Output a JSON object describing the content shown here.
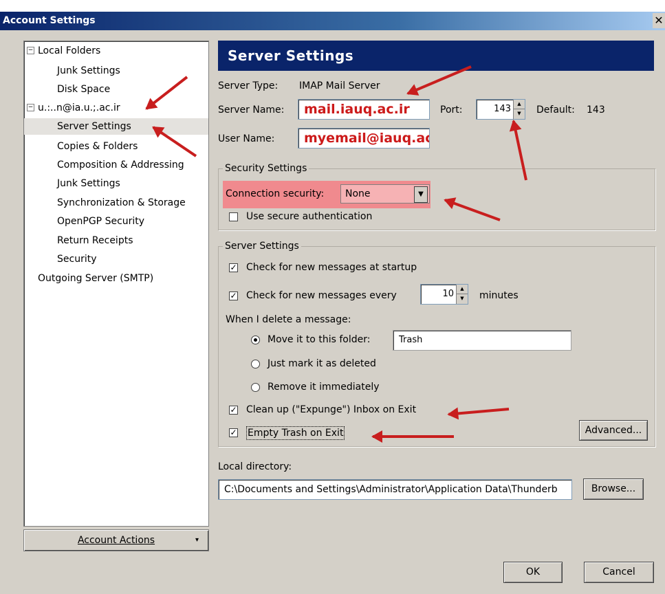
{
  "window": {
    "title": "Account Settings",
    "close_glyph": "✕"
  },
  "tree": {
    "expander_glyph": "−",
    "items": [
      {
        "label": "Local Folders"
      },
      {
        "label": "Junk Settings"
      },
      {
        "label": "Disk Space"
      },
      {
        "label": "u.:..n@ia.u.;.ac.ir"
      },
      {
        "label": "Server Settings"
      },
      {
        "label": "Copies & Folders"
      },
      {
        "label": "Composition & Addressing"
      },
      {
        "label": "Junk Settings"
      },
      {
        "label": "Synchronization & Storage"
      },
      {
        "label": "OpenPGP Security"
      },
      {
        "label": "Return Receipts"
      },
      {
        "label": "Security"
      },
      {
        "label": "Outgoing Server (SMTP)"
      }
    ],
    "account_actions": "Account Actions",
    "account_actions_arrow": "▾"
  },
  "panel": {
    "title": "Server Settings",
    "server_type_label": "Server Type:",
    "server_type_value": "IMAP Mail Server",
    "server_name_label": "Server Name:",
    "server_name_value": "mail.iauq.ac.ir",
    "port_label": "Port:",
    "port_value": "143",
    "default_label": "Default:",
    "default_value": "143",
    "user_name_label": "User Name:",
    "user_name_value": "myemail@iauq.ac.ir",
    "security_group_title": "Security Settings",
    "connection_security_label": "Connection security:",
    "connection_security_value": "None",
    "use_secure_auth_label": "Use secure authentication",
    "server_group_title": "Server Settings",
    "check_startup_label": "Check for new messages at startup",
    "check_every_label": "Check for new messages every",
    "check_every_value": "10",
    "minutes_label": "minutes",
    "delete_heading": "When I delete a message:",
    "move_folder_label": "Move it to this folder:",
    "move_folder_value": "Trash",
    "just_mark_label": "Just mark it as deleted",
    "remove_label": "Remove it immediately",
    "cleanup_label": "Clean up (\"Expunge\") Inbox on Exit",
    "empty_trash_label": "Empty Trash on Exit",
    "advanced_button": "Advanced...",
    "local_dir_label": "Local directory:",
    "local_dir_value": "C:\\Documents and Settings\\Administrator\\Application Data\\Thunderb",
    "browse_button": "Browse...",
    "ok_button": "OK",
    "cancel_button": "Cancel"
  },
  "glyphs": {
    "check": "✓",
    "spin_up": "▲",
    "spin_down": "▼",
    "dropdown": "▼"
  },
  "colors": {
    "title_bar": "#0a246a",
    "panel_header": "#0a246a",
    "annotation_red": "#c81e1e",
    "highlight": "#f08a8e",
    "value_red": "#cc1a1a"
  }
}
